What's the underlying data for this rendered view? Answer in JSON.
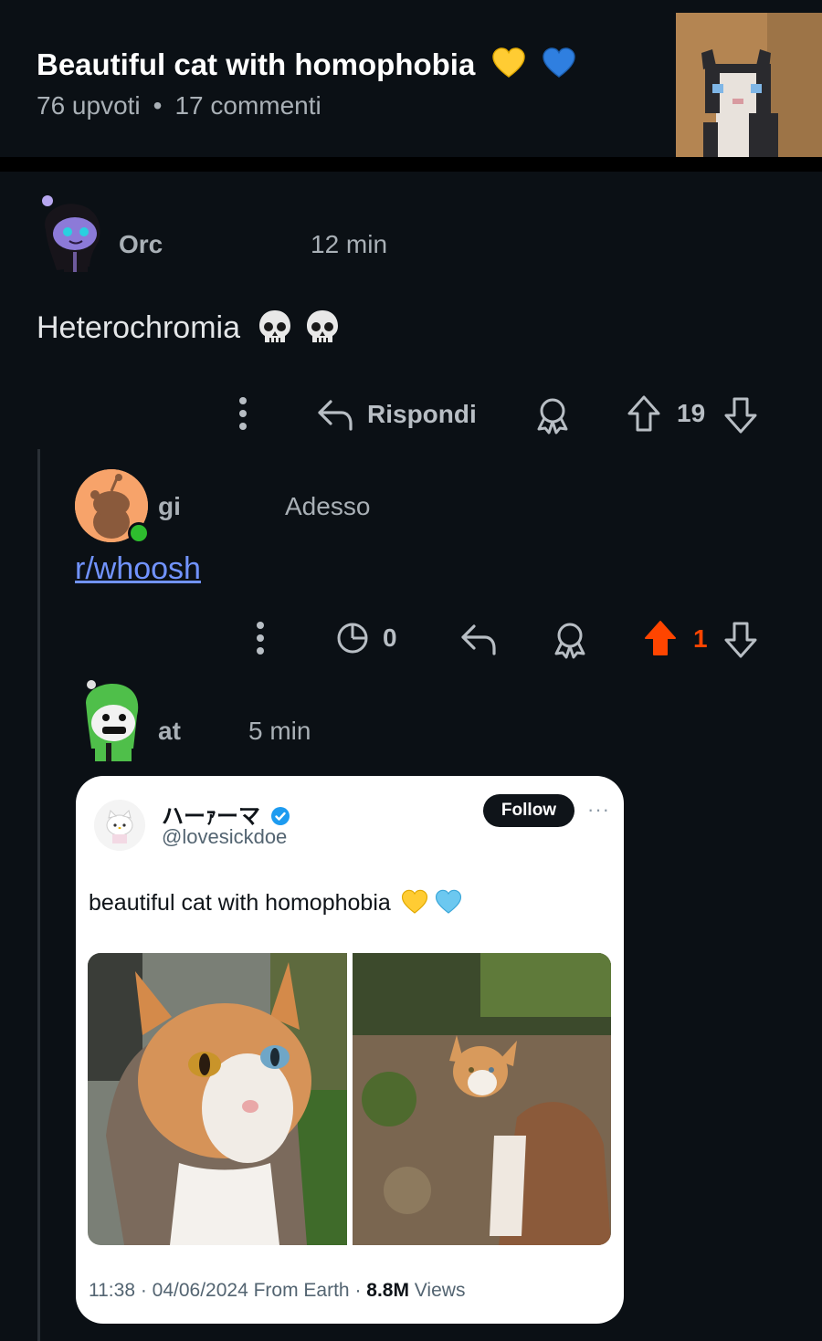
{
  "post": {
    "title": "Beautiful cat with homophobia",
    "upvotes": "76 upvoti",
    "separator": "•",
    "comments": "17 commenti"
  },
  "comments": [
    {
      "username": "Orc",
      "time": "12 min",
      "body": "Heterochromia",
      "actions": {
        "reply_label": "Rispondi",
        "score": "19"
      }
    },
    {
      "username": "gi",
      "time": "Adesso",
      "link": "r/whoosh",
      "actions": {
        "views": "0",
        "score": "1"
      }
    },
    {
      "username": "at",
      "time": "5 min"
    }
  ],
  "tweet": {
    "display_name": "ハーｧーマ",
    "handle": "@lovesickdoe",
    "follow_label": "Follow",
    "more": "···",
    "text": "beautiful cat with homophobia",
    "footer_time": "11:38 · 04/06/2024 From Earth · ",
    "footer_views_count": "8.8M",
    "footer_views_label": " Views"
  },
  "colors": {
    "background": "#0b1015",
    "upvote_active": "#ff4500",
    "link": "#7193ff",
    "online": "#2ebd2e"
  },
  "icons": [
    "yellow-heart-icon",
    "blue-heart-icon",
    "skull-icon",
    "more-vertical-icon",
    "reply-icon",
    "award-icon",
    "upvote-icon",
    "downvote-icon",
    "views-icon",
    "verified-icon"
  ]
}
